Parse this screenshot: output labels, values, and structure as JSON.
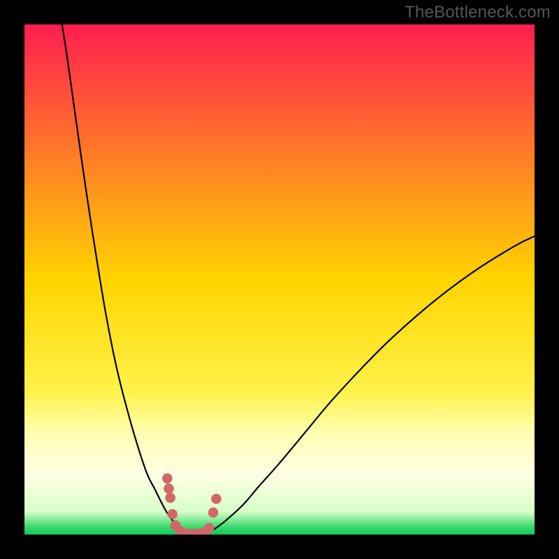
{
  "watermark": {
    "text": "TheBottleneck.com"
  },
  "chart_data": {
    "type": "line",
    "title": "",
    "xlabel": "",
    "ylabel": "",
    "axes_visible": false,
    "xlim": [
      0,
      100
    ],
    "ylim": [
      0,
      100
    ],
    "background_gradient": {
      "stops": [
        {
          "offset": 0.0,
          "color": "#ff1e50"
        },
        {
          "offset": 0.5,
          "color": "#ffd400"
        },
        {
          "offset": 0.72,
          "color": "#fff24a"
        },
        {
          "offset": 0.8,
          "color": "#ffffb0"
        },
        {
          "offset": 0.88,
          "color": "#ffffe4"
        },
        {
          "offset": 0.955,
          "color": "#d8ffc8"
        },
        {
          "offset": 0.985,
          "color": "#3bd96e"
        },
        {
          "offset": 1.0,
          "color": "#12c75c"
        }
      ]
    },
    "series": [
      {
        "name": "left-curve",
        "color": "#000000",
        "x": [
          6,
          8,
          10,
          12,
          14,
          16,
          18,
          20,
          22,
          24,
          25.5,
          27,
          28,
          29,
          30,
          31,
          32
        ],
        "y": [
          108,
          96,
          82,
          68,
          55,
          43,
          33,
          25,
          18,
          12,
          9,
          6,
          4.2,
          2.8,
          1.8,
          1.0,
          0.3
        ]
      },
      {
        "name": "right-curve",
        "color": "#000000",
        "x": [
          36,
          38,
          40,
          43,
          46,
          50,
          55,
          60,
          66,
          72,
          80,
          88,
          96,
          100
        ],
        "y": [
          0.3,
          1.6,
          3.2,
          6.0,
          9.5,
          14,
          20,
          26,
          32.5,
          38.5,
          45.5,
          51.5,
          56.5,
          58.5
        ]
      }
    ],
    "dots": {
      "name": "minimum-dots",
      "color": "#d16868",
      "radius": 1.0,
      "points": [
        {
          "x": 28.0,
          "y": 11.0
        },
        {
          "x": 28.3,
          "y": 9.0
        },
        {
          "x": 28.6,
          "y": 7.2
        },
        {
          "x": 29.0,
          "y": 4.0
        },
        {
          "x": 29.6,
          "y": 1.8
        },
        {
          "x": 30.5,
          "y": 0.7
        },
        {
          "x": 31.5,
          "y": 0.25
        },
        {
          "x": 32.5,
          "y": 0.15
        },
        {
          "x": 33.5,
          "y": 0.15
        },
        {
          "x": 34.5,
          "y": 0.2
        },
        {
          "x": 35.4,
          "y": 0.5
        },
        {
          "x": 36.2,
          "y": 1.3
        },
        {
          "x": 37.0,
          "y": 4.3
        },
        {
          "x": 37.6,
          "y": 7.0
        }
      ]
    }
  }
}
